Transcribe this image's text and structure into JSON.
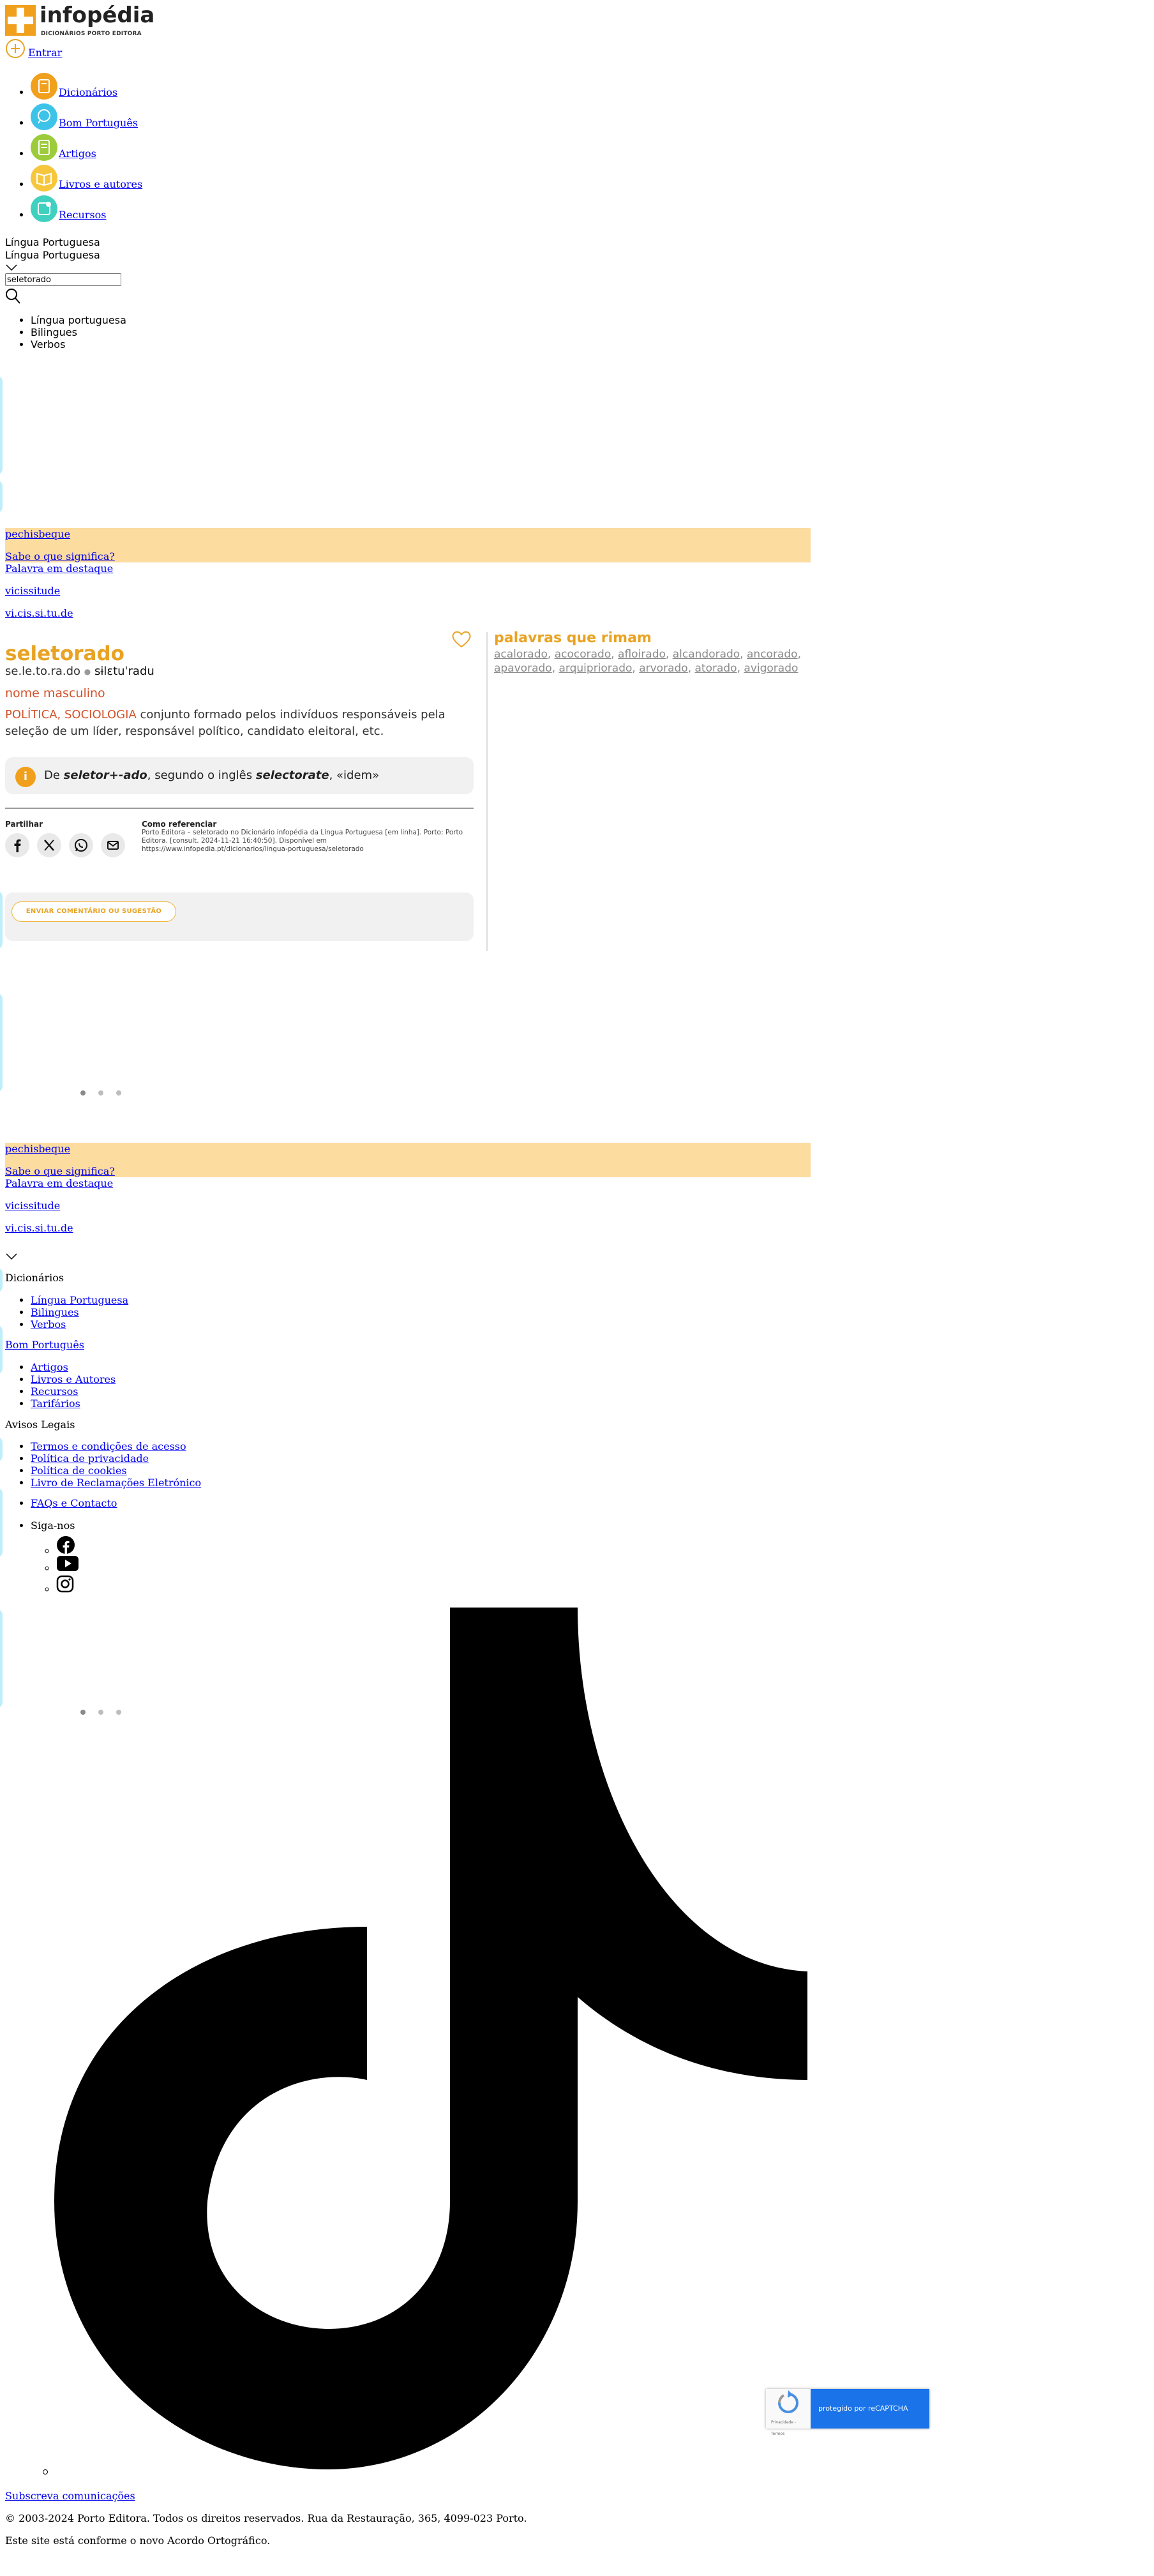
{
  "header": {
    "logo_name": "infopédia",
    "logo_sub": "DICIONÁRIOS PORTO EDITORA",
    "login_label": "Entrar",
    "nav": [
      {
        "label": "Dicionários",
        "color": "#f0a01c"
      },
      {
        "label": "Bom Português",
        "color": "#3ec3e8"
      },
      {
        "label": "Artigos",
        "color": "#9ccb3b"
      },
      {
        "label": "Livros e autores",
        "color": "#f6c73d"
      },
      {
        "label": "Recursos",
        "color": "#3fd0c0"
      }
    ]
  },
  "search": {
    "dict_selected": "Língua Portuguesa",
    "dict_selected_2": "Língua Portuguesa",
    "value": "seletorado",
    "dict_options": [
      "Língua portuguesa",
      "Bilingues",
      "Verbos"
    ]
  },
  "word_of_day": {
    "word": "pechisbeque",
    "question": "Sabe o que significa?",
    "highlight_label": "Palavra em destaque",
    "highlight_word": "vicissitude",
    "highlight_syllab": "vi.cis.si.tu.de"
  },
  "entry": {
    "headword": "seletorado",
    "syllabification": "se.le.to.ra.do",
    "pronunciation": "sɨlɛtuˈradu",
    "part_of_speech": "nome masculino",
    "domain": "POLÍTICA, SOCIOLOGIA",
    "definition": "conjunto formado pelos indivíduos responsáveis pela seleção de um líder, responsável político, candidato eleitoral, etc.",
    "etym_prefix": "De ",
    "etym_word": "seletor+-ado",
    "etym_mid": ", segundo o inglês ",
    "etym_word2": "selectorate",
    "etym_suffix": ", «idem»",
    "share_label": "Partilhar",
    "cite_label": "Como referenciar",
    "cite_text": "Porto Editora – seletorado no Dicionário infopédia da Língua Portuguesa [em linha]. Porto: Porto Editora. [consult. 2024-11-21 16:40:50]. Disponível em https://www.infopedia.pt/dicionarios/lingua-portuguesa/seletorado",
    "comment_button": "ENVIAR COMENTÁRIO OU SUGESTÃO"
  },
  "rhymes": {
    "title": "palavras que rimam",
    "words": [
      "acalorado",
      "acocorado",
      "afloirado",
      "alcandorado",
      "ancorado",
      "apavorado",
      "arquipriorado",
      "arvorado",
      "atorado",
      "avigorado"
    ]
  },
  "footer": {
    "dict_heading": "Dicionários",
    "dict_links": [
      "Língua Portuguesa",
      "Bilingues",
      "Verbos"
    ],
    "bom_portugues": "Bom Português",
    "more_links": [
      "Artigos",
      "Livros e Autores",
      "Recursos",
      "Tarifários"
    ],
    "legal_heading": "Avisos Legais",
    "legal_links": [
      "Termos e condições de acesso",
      "Política de privacidade",
      "Política de cookies",
      "Livro de Reclamações Eletrónico"
    ],
    "faq": "FAQs e Contacto",
    "follow": "Siga-nos",
    "subscribe": "Subscreva comunicações",
    "copyright": "© 2003-2024 Porto Editora. Todos os direitos reservados. Rua da Restauração, 365, 4099-023 Porto.",
    "agreement": "Este site está conforme o novo Acordo Ortográfico."
  },
  "recaptcha": {
    "label": "protegido por reCAPTCHA",
    "small": "Privacidade - Termos"
  },
  "colors": {
    "accent": "#e8a324",
    "band": "#fddca0",
    "domain": "#d1512a"
  }
}
